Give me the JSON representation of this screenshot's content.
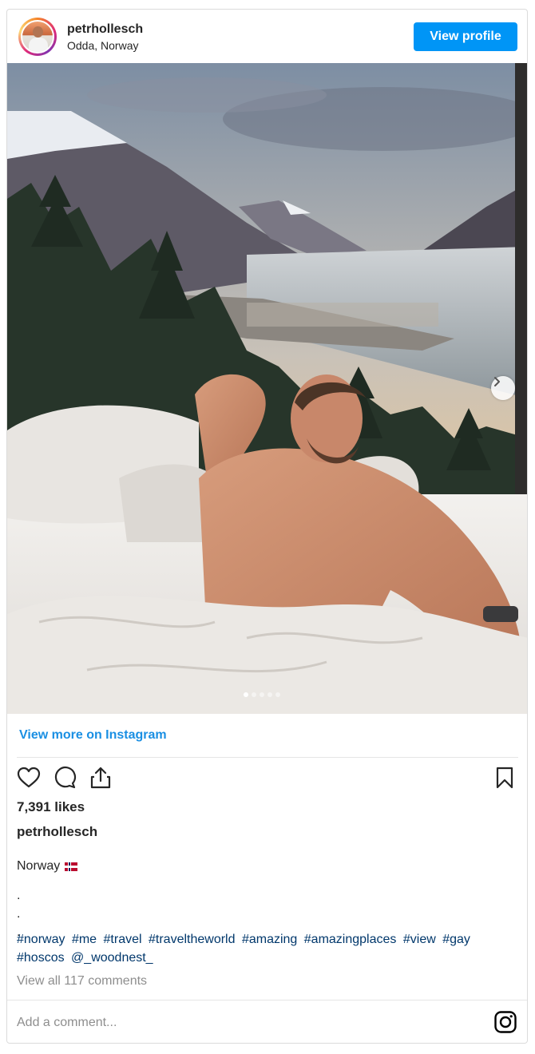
{
  "post": {
    "username": "petrhollesch",
    "location": "Odda, Norway",
    "view_profile_label": "View profile",
    "view_more_label": "View more on Instagram",
    "likes": "7,391 likes",
    "caption_user": "petrhollesch",
    "caption_title": "Norway",
    "caption_flag": "norway-flag-emoji",
    "caption_dots": [
      ".",
      ".",
      "."
    ],
    "hashtags": [
      "#norway",
      "#me",
      "#travel",
      "#traveltheworld",
      "#amazing",
      "#amazingplaces",
      "#view",
      "#gay",
      "#hoscos",
      "@_woodnest_"
    ],
    "view_all_comments": "View all 117 comments",
    "add_comment_placeholder": "Add a comment...",
    "carousel": {
      "slides": 5,
      "active_index": 0
    }
  },
  "icons": {
    "like": "heart-icon",
    "comment": "comment-icon",
    "share": "share-icon",
    "save": "bookmark-icon",
    "next": "chevron-right-icon",
    "brand": "instagram-icon"
  },
  "colors": {
    "primary_button": "#0095f6",
    "link": "#1a8fe3",
    "hashtag": "#00376b",
    "muted": "#8e8e8e",
    "text": "#262626",
    "border": "#dbdbdb"
  }
}
